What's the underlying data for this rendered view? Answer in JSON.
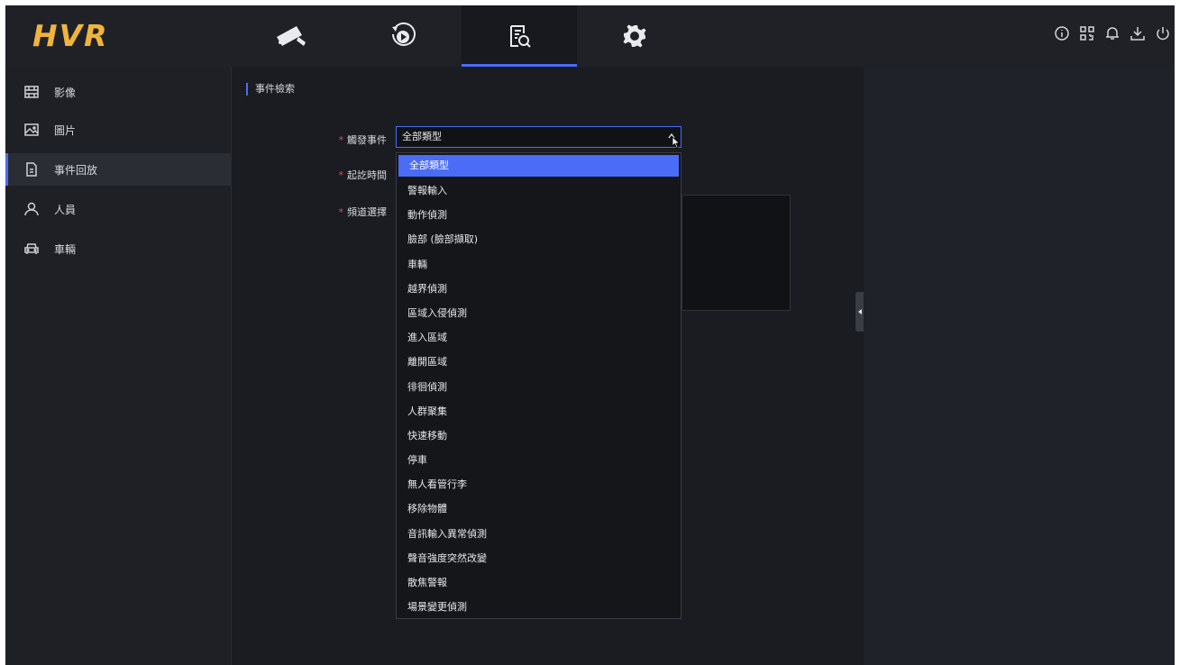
{
  "app": {
    "logo": "HVR"
  },
  "nav": {
    "tabs": [
      {
        "name": "live-view",
        "icon": "camera-icon",
        "active": false
      },
      {
        "name": "playback",
        "icon": "playback-icon",
        "active": false
      },
      {
        "name": "search",
        "icon": "file-search-icon",
        "active": true
      },
      {
        "name": "settings",
        "icon": "gear-icon",
        "active": false
      }
    ],
    "tools": [
      "info-icon",
      "qr-code-icon",
      "bell-icon",
      "download-icon",
      "power-icon"
    ]
  },
  "sidebar": {
    "items": [
      {
        "label": "影像",
        "icon": "film-icon",
        "active": false
      },
      {
        "label": "圖片",
        "icon": "image-icon",
        "active": false
      },
      {
        "label": "事件回放",
        "icon": "document-icon",
        "active": true
      },
      {
        "label": "人員",
        "icon": "person-icon",
        "active": false
      },
      {
        "label": "車輛",
        "icon": "car-icon",
        "active": false
      }
    ]
  },
  "main": {
    "section_title": "事件檢索",
    "form": {
      "trigger_label": "觸發事件",
      "time_label": "起訖時間",
      "channel_label": "頻道選擇",
      "selected_value": "全部類型"
    },
    "dropdown": {
      "options": [
        "全部類型",
        "警報輸入",
        "動作偵測",
        "臉部 (臉部擷取)",
        "車輛",
        "越界偵測",
        "區域入侵偵測",
        "進入區域",
        "離開區域",
        "徘徊偵測",
        "人群聚集",
        "快速移動",
        "停車",
        "無人看管行李",
        "移除物體",
        "音訊輸入異常偵測",
        "聲音強度突然改變",
        "散焦警報",
        "場景變更偵測"
      ],
      "selected_index": 0
    }
  },
  "colors": {
    "accent": "#4a6cf7",
    "logo": "#f0b43c",
    "required": "#e14b4b"
  }
}
